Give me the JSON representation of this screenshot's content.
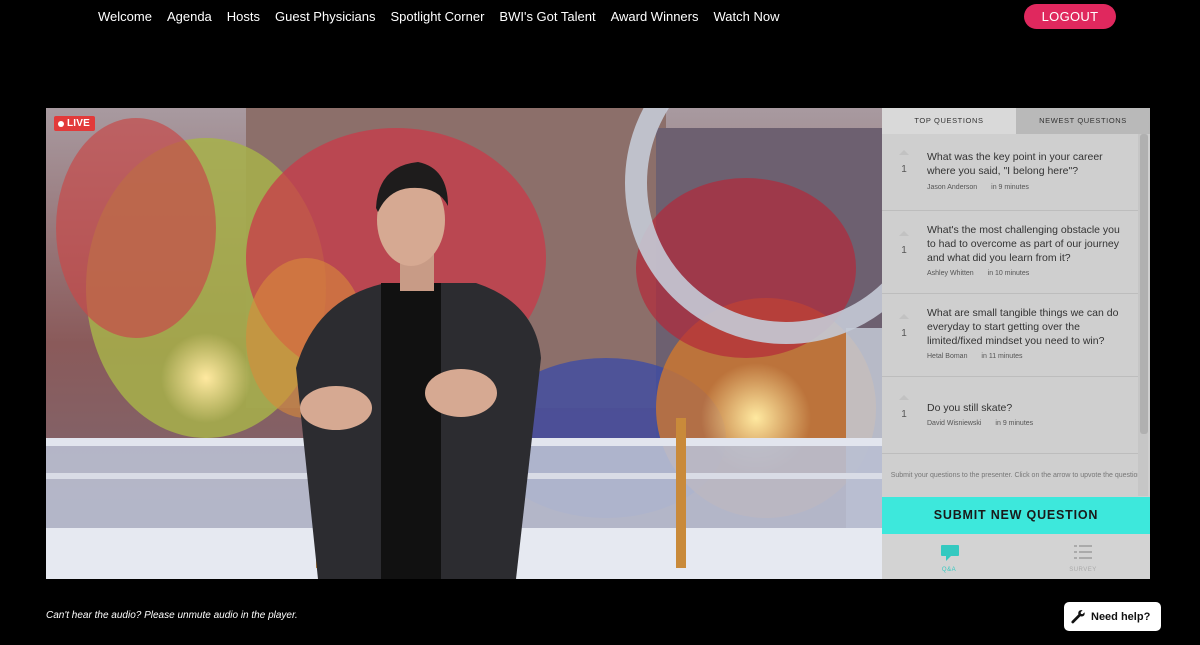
{
  "nav": {
    "items": [
      "Welcome",
      "Agenda",
      "Hosts",
      "Guest Physicians",
      "Spotlight Corner",
      "BWI's Got Talent",
      "Award Winners",
      "Watch Now"
    ],
    "logout_label": "LOGOUT"
  },
  "video": {
    "live_label": "LIVE"
  },
  "qa": {
    "tabs": [
      "TOP QUESTIONS",
      "NEWEST QUESTIONS"
    ],
    "questions": [
      {
        "text": "What was the key point in your career where you said, \"I belong here\"?",
        "votes": "1",
        "author": "Jason Anderson",
        "time": "in 9 minutes"
      },
      {
        "text": "What's the most challenging obstacle you to had to overcome as part of our journey and what did you learn from it?",
        "votes": "1",
        "author": "Ashley Whitten",
        "time": "in 10 minutes"
      },
      {
        "text": "What are small tangible things we can do everyday to start getting over the limited/fixed mindset you need to win?",
        "votes": "1",
        "author": "Hetal Boman",
        "time": "in 11 minutes"
      },
      {
        "text": "Do you still skate?",
        "votes": "1",
        "author": "David Wisniewski",
        "time": "in 9 minutes"
      }
    ],
    "hint": "Submit your questions to the presenter. Click on the arrow to upvote the question",
    "submit_label": "SUBMIT NEW QUESTION",
    "bottom_tabs": [
      {
        "icon": "chat-icon",
        "label": "Q&A"
      },
      {
        "icon": "list-icon",
        "label": "SURVEY"
      }
    ]
  },
  "footer": {
    "audio_note": "Can't hear the audio? Please unmute audio in the player.",
    "help_label": "Need help?"
  },
  "colors": {
    "logout": "#e0285e",
    "submit": "#3de8dc",
    "live": "#e23a3a"
  }
}
